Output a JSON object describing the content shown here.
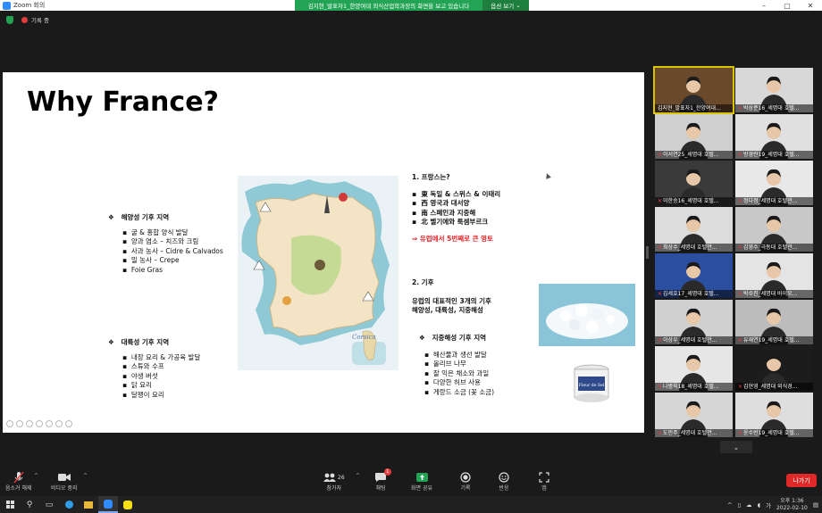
{
  "titlebar": {
    "app_title": "Zoom 회의"
  },
  "share_banner": {
    "text": "김지현_발표자1_한양여대 외식산업학과장의 화면을 보고 있습니다",
    "view_options": "옵션 보기"
  },
  "meeting": {
    "recording_label": "기록 중"
  },
  "slide": {
    "title": "Why France?",
    "oceanic": {
      "heading": "해양성 기후 지역",
      "items": [
        "굴 & 홍합 양식 발달",
        "양과 염소 – 치즈와 크림",
        "사과 농사 – Cidre & Calvados",
        "밀 농사 – Crepe",
        "Foie Gras"
      ]
    },
    "continental": {
      "heading": "대륙성 기후 지역",
      "items": [
        "내장 요리 & 가공육 발달",
        "스튜와 수프",
        "야생 버섯",
        "닭 요리",
        "달팽이 요리"
      ]
    },
    "france_info": {
      "heading": "1. 프랑스는?",
      "items": [
        "東 독일 & 스위스 & 이태리",
        "西 영국과 대서양",
        "南 스페인과 지중해",
        "北 벨기에와 룩셈부르크"
      ],
      "highlight": "⇒  유럽에서 5번째로 큰 영토"
    },
    "climate": {
      "heading": "2. 기후",
      "desc_line1": "유럽의 대표적인 3개의 기후",
      "desc_line2": "해양성, 대륙성, 지중해성"
    },
    "mediterranean": {
      "heading": "지중해성 기후 지역",
      "items": [
        "해산물과 생선 발달",
        "올리브 나무",
        "잘 익은 채소와 과일",
        "다양한 허브 사용",
        "게랑드 소금 (꽃 소금)"
      ]
    },
    "map_label": "Corsica",
    "jar_label": "Fleur de Sel"
  },
  "participants": [
    {
      "name": "김지현_발표자1_한양여대...",
      "muted": false,
      "active": true
    },
    {
      "name": "박상준16_세명대 호텔...",
      "muted": true
    },
    {
      "name": "이서연25_세명대 호텔...",
      "muted": true
    },
    {
      "name": "방경란19_세명대 호텔...",
      "muted": true
    },
    {
      "name": "이한승16_세명대 호텔...",
      "muted": true
    },
    {
      "name": "정다정_세명대 호텔관...",
      "muted": true
    },
    {
      "name": "최상수_세명대 호텔관...",
      "muted": true
    },
    {
      "name": "김영수_극동대 호텔관...",
      "muted": true
    },
    {
      "name": "김세호17_세명대 호텔...",
      "muted": true
    },
    {
      "name": "박수진_세명대 바이오...",
      "muted": true
    },
    {
      "name": "이상우_세명대 호텔관...",
      "muted": true
    },
    {
      "name": "유재연19_세명대 호텔...",
      "muted": true
    },
    {
      "name": "나병욱18_세명대 호텔...",
      "muted": true
    },
    {
      "name": "김현영_세명대 외식경...",
      "muted": true
    },
    {
      "name": "도민주_세명대 호텔관...",
      "muted": true
    },
    {
      "name": "윤수빈19_세명대 호텔...",
      "muted": true
    }
  ],
  "toolbar": {
    "mute_label": "음소거 해제",
    "video_label": "비디오 중지",
    "participants_label": "참가자",
    "participants_count": "26",
    "chat_label": "채팅",
    "chat_badge": "1",
    "share_label": "화면 공유",
    "record_label": "기록",
    "reactions_label": "반응",
    "apps_label": "앱",
    "leave_label": "나가기"
  },
  "taskbar": {
    "time": "오후 1:36",
    "date": "2022-02-10",
    "ime": "가"
  },
  "colors": {
    "accent_green": "#23a455",
    "leave_red": "#e02828",
    "active_outline": "#d8c400"
  }
}
